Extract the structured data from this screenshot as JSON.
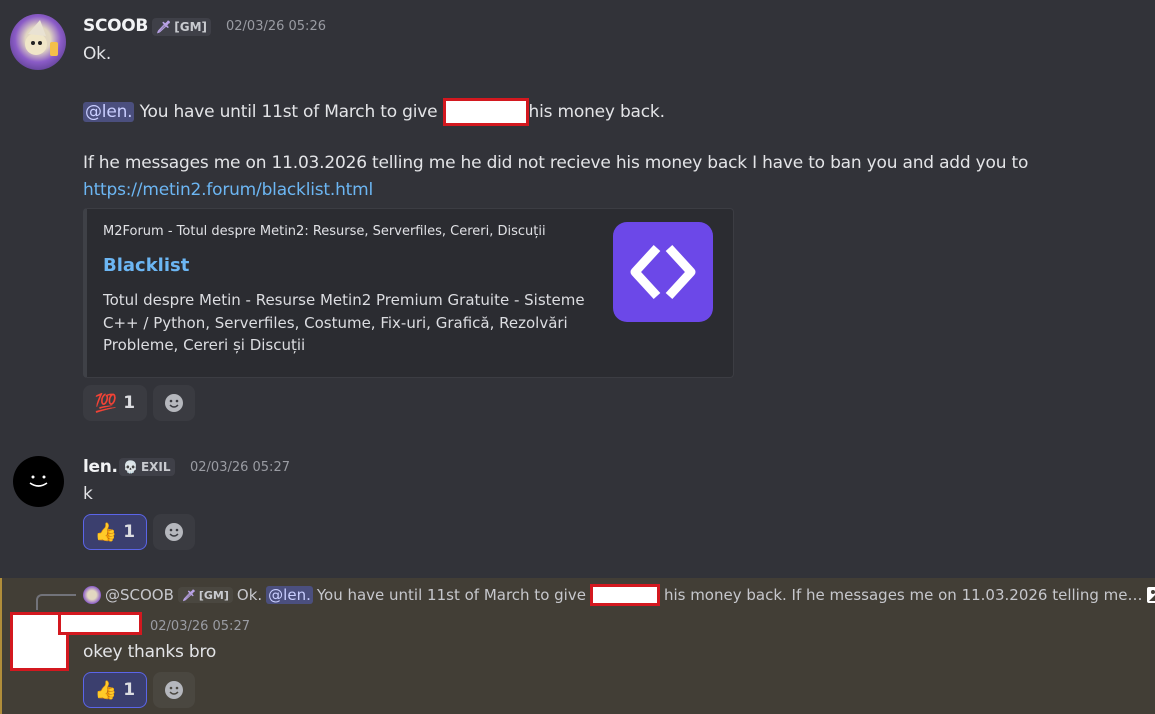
{
  "messages": [
    {
      "author": "SCOOB",
      "role_tag": "[GM]",
      "timestamp": "02/03/26 05:26",
      "lines": {
        "l1": "Ok.",
        "mention": "@len.",
        "l2_pre": " You have until 11st of March to give ",
        "l2_post": "his money back.",
        "l3": "If he messages me on 11.03.2026 telling me he did not recieve his money back I have to ban you and add you to",
        "link": "https://metin2.forum/blacklist.html"
      },
      "embed": {
        "provider": "M2Forum - Totul despre Metin2: Resurse, Serverfiles, Cereri, Discuții",
        "title": "Blacklist",
        "description": "Totul despre Metin - Resurse Metin2 Premium Gratuite - Sisteme C++ / Python, Serverfiles, Costume, Fix-uri, Grafică, Rezolvări Probleme, Cereri și Discuții"
      },
      "reaction": {
        "emoji": "💯",
        "count": "1"
      }
    },
    {
      "author": "len.",
      "role_tag": "EXIL",
      "timestamp": "02/03/26 05:27",
      "text": "k",
      "reaction": {
        "emoji": "👍",
        "count": "1"
      }
    },
    {
      "reply": {
        "author": "@SCOOB",
        "role_tag": "[GM]",
        "p1": "Ok.",
        "mention": "@len.",
        "p2": "You have until 11st of March to give",
        "p3": "his money back.  If he messages me on 11.03.2026 telling me…"
      },
      "timestamp": "02/03/26 05:27",
      "text": "okey thanks bro",
      "reaction": {
        "emoji": "👍",
        "count": "1"
      }
    }
  ],
  "colors": {
    "background": "#323339",
    "mention_bg": "#4b4f7e",
    "link": "#6cb6f3",
    "highlight": "#423e36",
    "redaction": "#d3181f"
  }
}
